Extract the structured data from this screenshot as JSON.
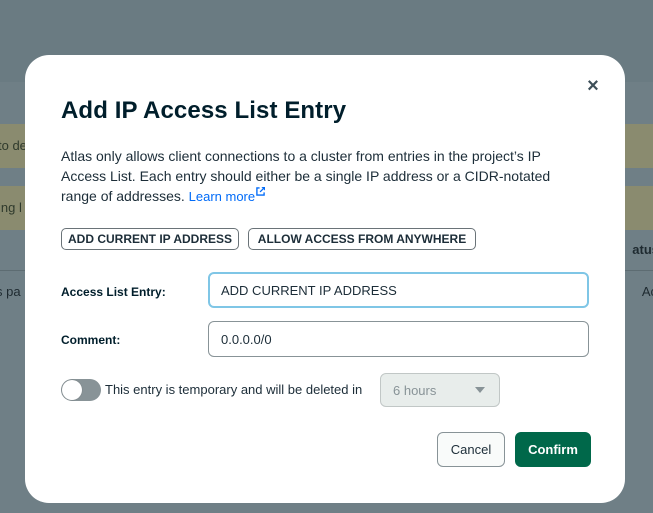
{
  "background": {
    "banner1_text": "to de",
    "banner2_text": "ing l",
    "status_header": "atus",
    "row_left_text": "s pa",
    "row_right_text": "Ac"
  },
  "modal": {
    "title": "Add IP Access List Entry",
    "close_icon": "close-icon",
    "description": "Atlas only allows client connections to a cluster from entries in the project’s IP Access List. Each entry should either be a single IP address or a CIDR-notated range of addresses.",
    "learn_more": "Learn more",
    "add_current_ip_label": "ADD CURRENT IP ADDRESS",
    "allow_anywhere_label": "ALLOW ACCESS FROM ANYWHERE",
    "access_list_entry_label": "Access List Entry:",
    "access_list_entry_value": "ADD CURRENT IP ADDRESS",
    "comment_label": "Comment:",
    "comment_value": "0.0.0.0/0",
    "temporary_toggle_on": false,
    "temporary_text": "This entry is temporary and will be deleted in",
    "duration_selected": "6 hours",
    "cancel_label": "Cancel",
    "confirm_label": "Confirm"
  },
  "colors": {
    "overlay": "#6f7f86",
    "confirm_bg": "#00684a",
    "link": "#016bf8",
    "focus_ring": "#7fc6e6"
  }
}
